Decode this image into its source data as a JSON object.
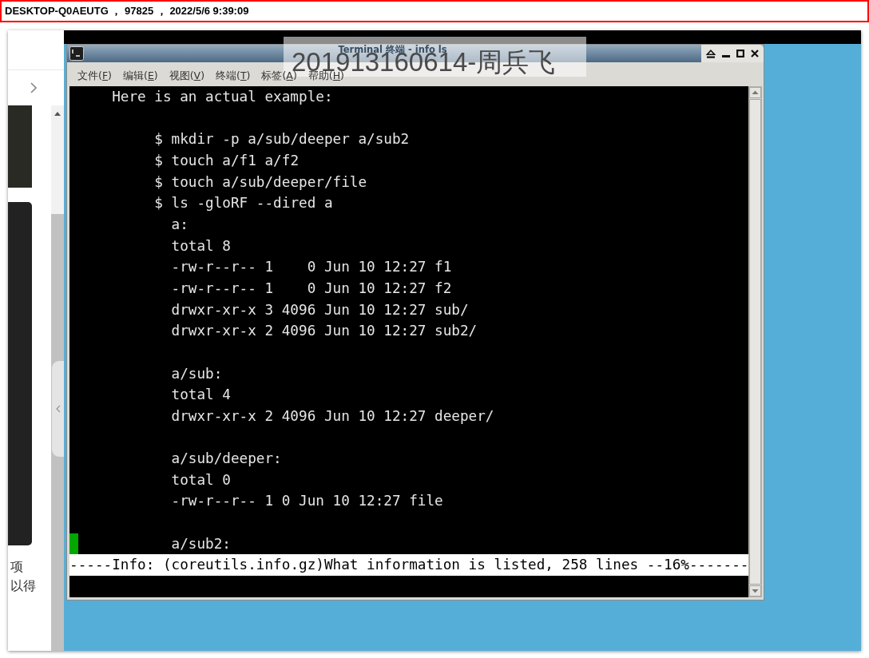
{
  "header": {
    "text": "DESKTOP-Q0AEUTG ， 97825 ， 2022/5/6 9:39:09"
  },
  "side_panel": {
    "texts": [
      "项",
      "以得"
    ]
  },
  "overlay_label": {
    "text": "201913160614-周兵飞"
  },
  "terminal": {
    "title": "Terminal 终端 - info ls",
    "menu": [
      {
        "label": "文件(F)"
      },
      {
        "label": "编辑(E)"
      },
      {
        "label": "视图(V)"
      },
      {
        "label": "终端(T)"
      },
      {
        "label": "标签(A)"
      },
      {
        "label": "帮助(H)"
      }
    ],
    "lines": [
      {
        "kind": "text",
        "text": "     Here is an actual example:",
        "cursor": false
      },
      {
        "kind": "blank",
        "cursor": false
      },
      {
        "kind": "text",
        "text": "          $ mkdir -p a/sub/deeper a/sub2",
        "cursor": false
      },
      {
        "kind": "text",
        "text": "          $ touch a/f1 a/f2",
        "cursor": false
      },
      {
        "kind": "text",
        "text": "          $ touch a/sub/deeper/file",
        "cursor": false
      },
      {
        "kind": "text",
        "text": "          $ ls -gloRF --dired a",
        "cursor": false
      },
      {
        "kind": "text",
        "text": "            a:",
        "cursor": false
      },
      {
        "kind": "text",
        "text": "            total 8",
        "cursor": false
      },
      {
        "kind": "text",
        "text": "            -rw-r--r-- 1    0 Jun 10 12:27 f1",
        "cursor": false
      },
      {
        "kind": "text",
        "text": "            -rw-r--r-- 1    0 Jun 10 12:27 f2",
        "cursor": false
      },
      {
        "kind": "text",
        "text": "            drwxr-xr-x 3 4096 Jun 10 12:27 sub/",
        "cursor": false
      },
      {
        "kind": "text",
        "text": "            drwxr-xr-x 2 4096 Jun 10 12:27 sub2/",
        "cursor": false
      },
      {
        "kind": "blank",
        "cursor": false
      },
      {
        "kind": "text",
        "text": "            a/sub:",
        "cursor": false
      },
      {
        "kind": "text",
        "text": "            total 4",
        "cursor": false
      },
      {
        "kind": "text",
        "text": "            drwxr-xr-x 2 4096 Jun 10 12:27 deeper/",
        "cursor": false
      },
      {
        "kind": "blank",
        "cursor": false
      },
      {
        "kind": "text",
        "text": "            a/sub/deeper:",
        "cursor": false
      },
      {
        "kind": "text",
        "text": "            total 0",
        "cursor": false
      },
      {
        "kind": "text",
        "text": "            -rw-r--r-- 1 0 Jun 10 12:27 file",
        "cursor": false
      },
      {
        "kind": "blank",
        "cursor": false
      },
      {
        "kind": "text",
        "text": "            a/sub2:",
        "cursor": true
      },
      {
        "kind": "status",
        "text": "-----Info: (coreutils.info.gz)What information is listed, 258 lines --16%-------",
        "cursor": false
      },
      {
        "kind": "blank",
        "cursor": false
      }
    ]
  }
}
